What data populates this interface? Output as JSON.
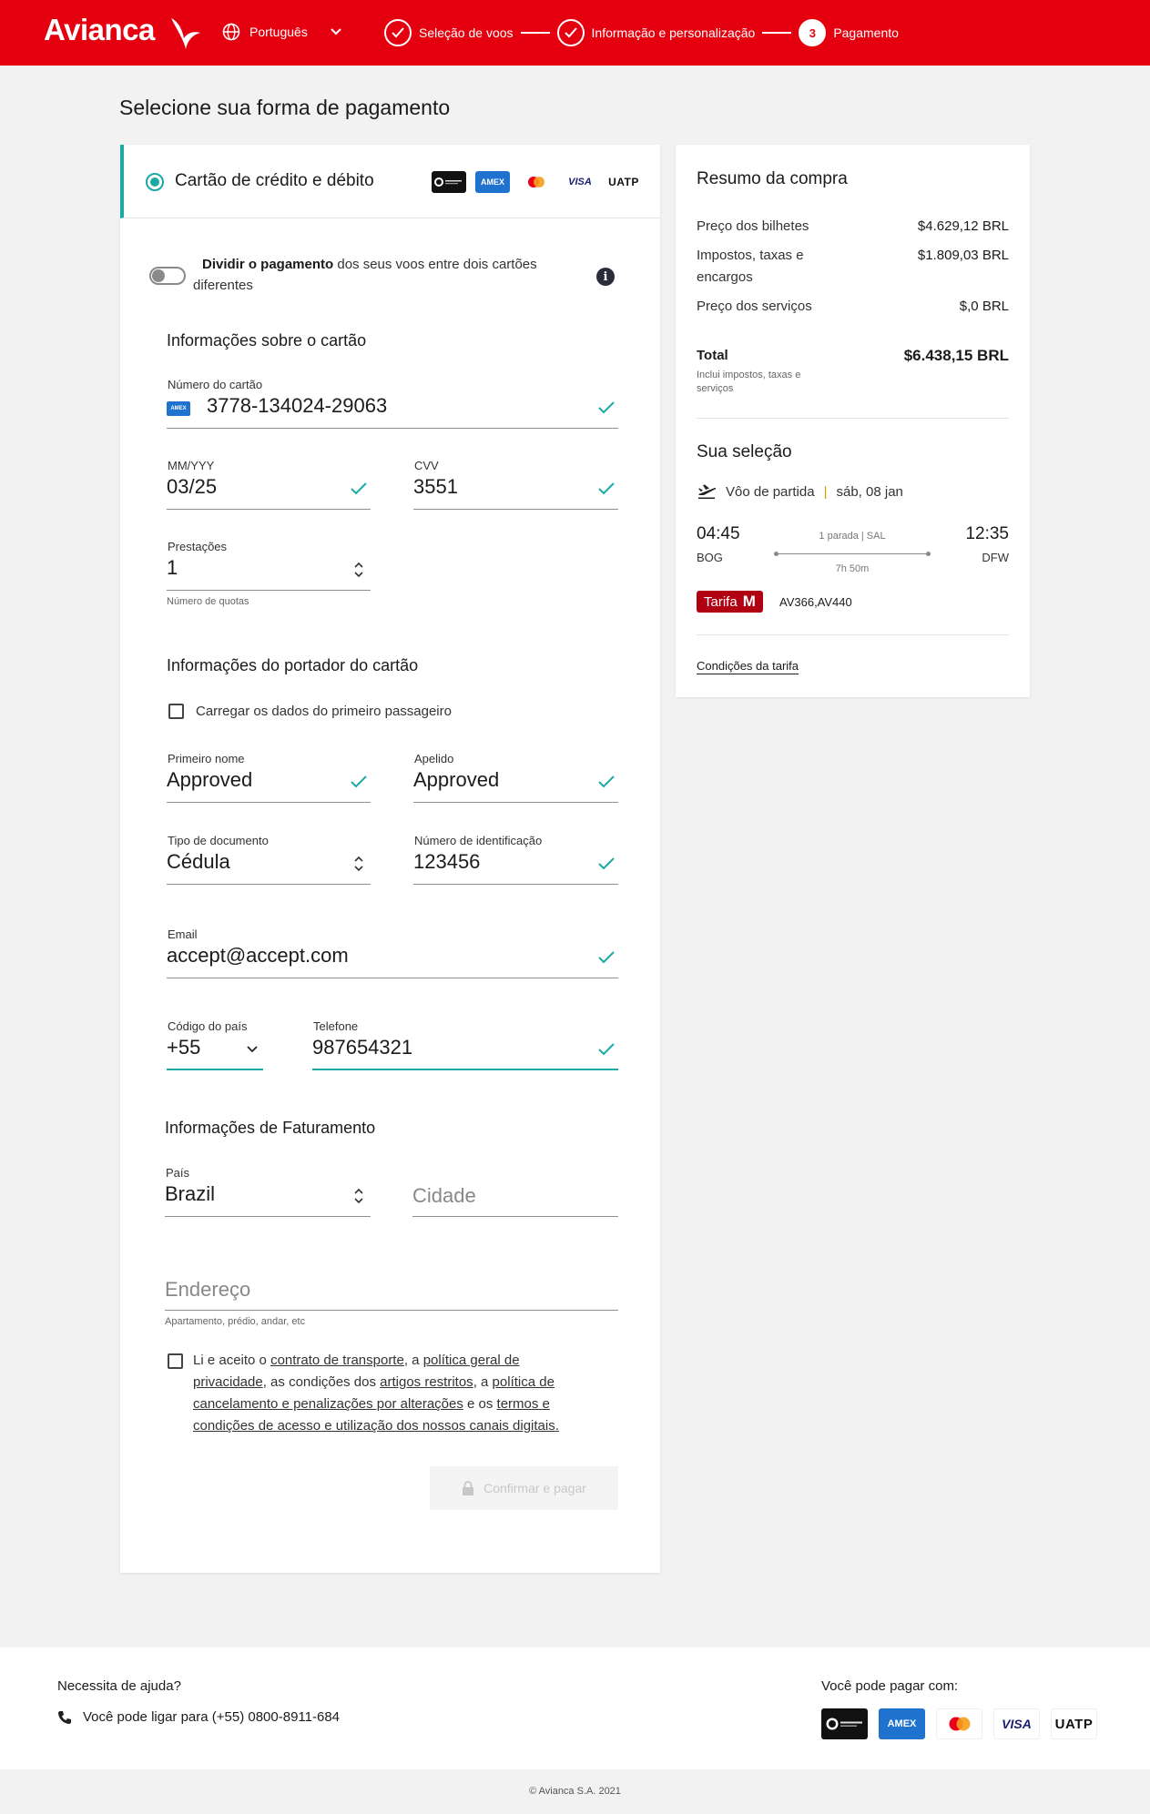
{
  "header": {
    "brand": "Avianca",
    "language": "Português",
    "steps": [
      {
        "label": "Seleção de voos",
        "state": "done"
      },
      {
        "label": "Informação e personalização",
        "state": "done"
      },
      {
        "label": "Pagamento",
        "state": "current",
        "number": "3"
      }
    ]
  },
  "page": {
    "title": "Selecione sua forma de pagamento"
  },
  "payment_method": {
    "label": "Cartão de crédito e débito",
    "brands": [
      "Diners Club",
      "AMEX",
      "Mastercard",
      "VISA",
      "UATP"
    ],
    "brand_labels": {
      "amex": "AMEX",
      "visa": "VISA",
      "uatp": "UATP",
      "diners": "Diners Club"
    }
  },
  "split": {
    "bold": "Dividir o pagamento",
    "rest": " dos seus voos entre dois cartões diferentes"
  },
  "card_info": {
    "title": "Informações sobre o cartão",
    "number_label": "Número do cartão",
    "number_value": "3778-134024-29063",
    "expiry_label": "MM/YYY",
    "expiry_value": "03/25",
    "cvv_label": "CVV",
    "cvv_value": "3551",
    "installments_label": "Prestações",
    "installments_value": "1",
    "installments_helper": "Número de quotas"
  },
  "holder_info": {
    "title": "Informações do portador do cartão",
    "load_passenger": "Carregar os dados do primeiro passageiro",
    "first_name_label": "Primeiro nome",
    "first_name_value": "Approved",
    "last_name_label": "Apelido",
    "last_name_value": "Approved",
    "doc_type_label": "Tipo de documento",
    "doc_type_value": "Cédula",
    "id_label": "Número de identificação",
    "id_value": "123456",
    "email_label": "Email",
    "email_value": "accept@accept.com",
    "country_code_label": "Código do país",
    "country_code_value": "+55",
    "phone_label": "Telefone",
    "phone_value": "987654321"
  },
  "billing": {
    "title": "Informações de Faturamento",
    "country_label": "País",
    "country_value": "Brazil",
    "city_placeholder": "Cidade",
    "address_placeholder": "Endereço",
    "address_helper": "Apartamento, prédio, andar, etc"
  },
  "terms": {
    "t1": "Li e aceito o ",
    "l1": "contrato de transporte",
    "t2": ", a ",
    "l2": "política geral de privacidade",
    "t3": ", as condições dos ",
    "l3": "artigos restritos",
    "t4": ", a ",
    "l4": "política de cancelamento e penalizações por alterações",
    "t5": " e os ",
    "l5": "termos e condições de acesso e utilização dos nossos canais digitais."
  },
  "confirm_button": "Confirmar e pagar",
  "summary": {
    "title": "Resumo da compra",
    "rows": [
      {
        "label": "Preço dos bilhetes",
        "value": "$4.629,12 BRL"
      },
      {
        "label": "Impostos, taxas e encargos",
        "value": "$1.809,03 BRL"
      },
      {
        "label": "Preço dos serviços",
        "value": "$,0 BRL"
      }
    ],
    "total_label": "Total",
    "total_note": "Inclui impostos, taxas e serviços",
    "total_value": "$6.438,15 BRL"
  },
  "selection": {
    "title": "Sua seleção",
    "departure_label": "Vôo de partida",
    "separator": "|",
    "departure_date": "sáb, 08 jan",
    "dep_time": "04:45",
    "dep_code": "BOG",
    "arr_time": "12:35",
    "arr_code": "DFW",
    "stops": "1 parada | SAL",
    "duration": "7h 50m",
    "fare_prefix": "Tarifa",
    "fare_class": "M",
    "flights": "AV366,AV440",
    "conditions_link": "Condições da tarifa"
  },
  "footer": {
    "help_title": "Necessita de ajuda?",
    "phone_text": "Você pode ligar para (+55) 0800-8911-684",
    "pay_with": "Você pode pagar com:",
    "copyright": "© Avianca S.A. 2021"
  },
  "colors": {
    "brand_red": "#e4000f",
    "accent_teal": "#1aa9a5",
    "fare_red": "#b00012"
  }
}
